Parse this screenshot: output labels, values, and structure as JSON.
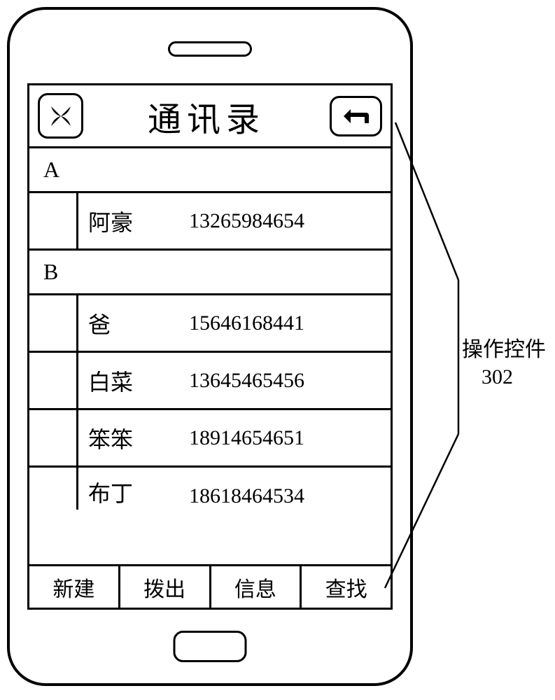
{
  "header": {
    "title": "通讯录"
  },
  "sections": [
    {
      "letter": "A"
    },
    {
      "letter": "B"
    }
  ],
  "contacts": {
    "a": [
      {
        "name": "阿豪",
        "phone": "13265984654"
      }
    ],
    "b": [
      {
        "name": "爸",
        "phone": "15646168441"
      },
      {
        "name": "白菜",
        "phone": "13645465456"
      },
      {
        "name": "笨笨",
        "phone": "18914654651"
      },
      {
        "name": "布丁",
        "phone": "18618464534"
      }
    ]
  },
  "actions": {
    "new": "新建",
    "dial": "拨出",
    "info": "信息",
    "find": "查找"
  },
  "annotation": {
    "label": "操作控件",
    "number": "302"
  }
}
